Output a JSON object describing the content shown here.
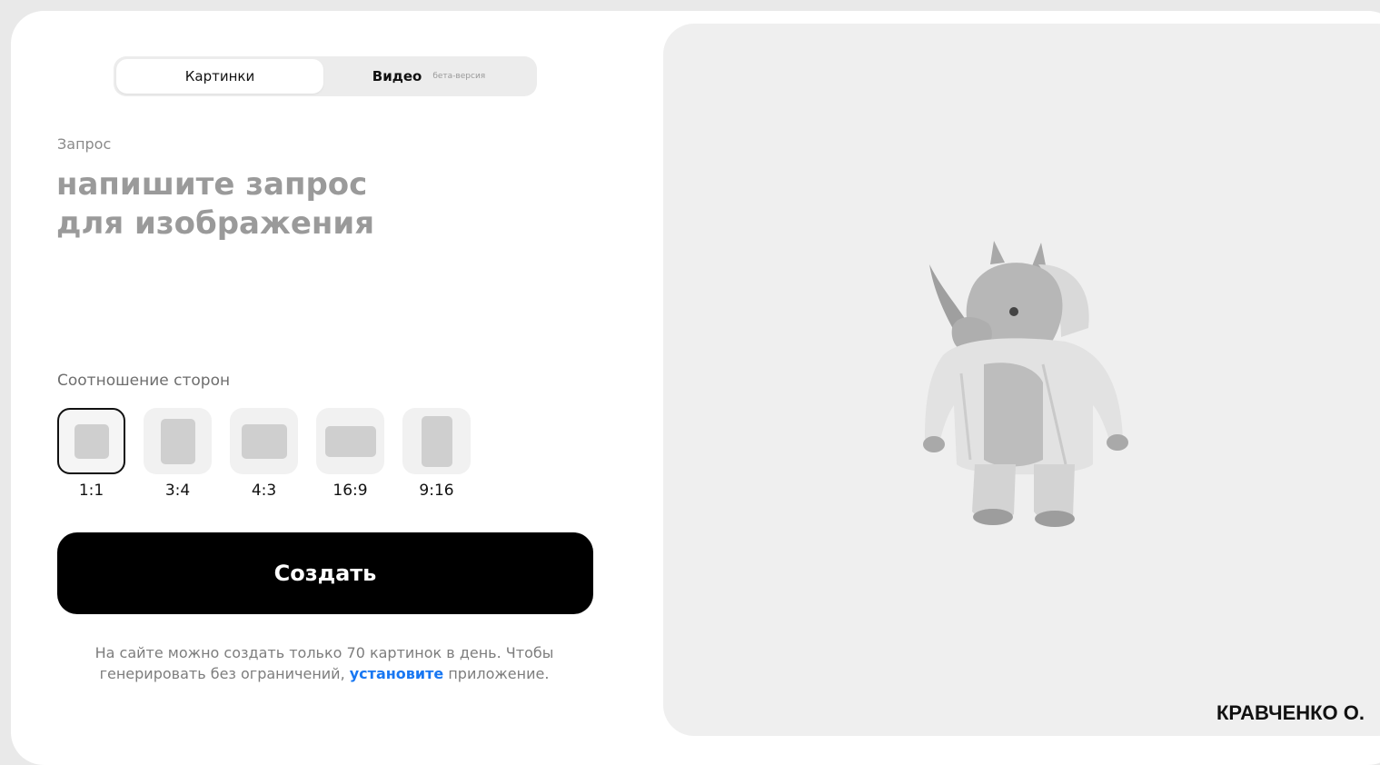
{
  "tabs": [
    {
      "label": "Картинки",
      "active": true
    },
    {
      "label": "Видео",
      "badge": "бета-версия",
      "active": false
    }
  ],
  "query": {
    "label": "Запрос",
    "placeholder": "напишите запрос\nдля изображения",
    "value": ""
  },
  "aspect_ratio": {
    "label": "Соотношение сторон",
    "selected": "1:1",
    "options": [
      "1:1",
      "3:4",
      "4:3",
      "16:9",
      "9:16"
    ]
  },
  "create_button": {
    "label": "Создать"
  },
  "note": {
    "text_before": "На сайте можно создать только 70 картинок в день. Чтобы генерировать без ограничений, ",
    "link_text": "установите",
    "text_after": " приложение."
  },
  "watermark": "КРАВЧЕНКО О.",
  "colors": {
    "accent_link": "#1877f2",
    "button_bg": "#000000",
    "preview_bg": "#efefef"
  },
  "icons": {
    "preview_illustration": "rhino-in-jacket-illustration"
  }
}
